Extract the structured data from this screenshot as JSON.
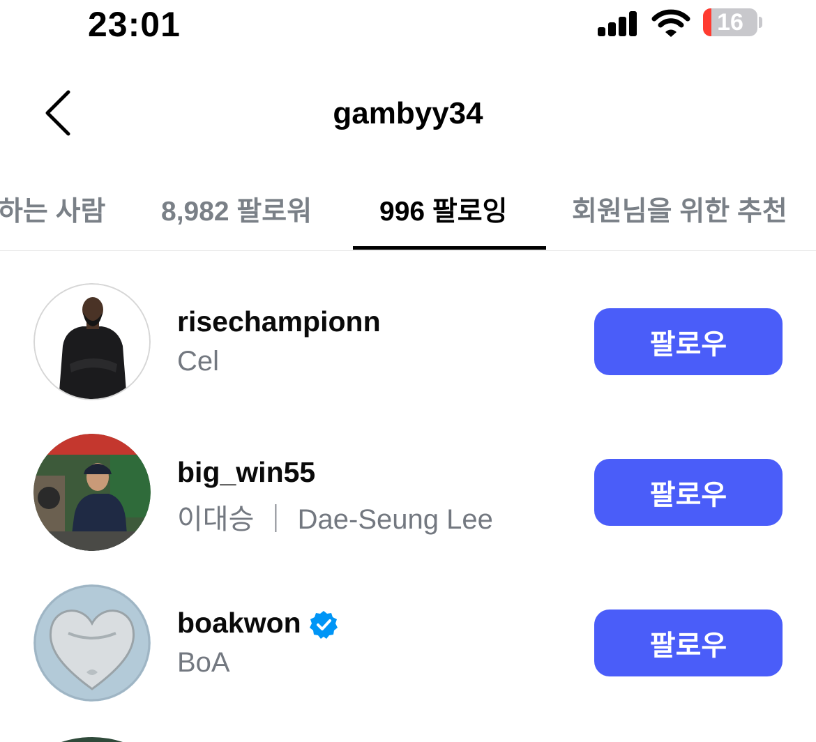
{
  "status_bar": {
    "time": "23:01",
    "battery_level": "16",
    "battery_fraction": 0.16,
    "icons": [
      "cellular-signal-icon",
      "wifi-icon",
      "battery-icon"
    ]
  },
  "header": {
    "back_icon": "chevron-left-icon",
    "title": "gambyy34"
  },
  "tabs": [
    {
      "label": "하는 사람",
      "active": false
    },
    {
      "label": "8,982 팔로워",
      "active": false
    },
    {
      "label": "996 팔로잉",
      "active": true
    },
    {
      "label": "회원님을 위한 추천",
      "active": false
    }
  ],
  "accounts": [
    {
      "username": "risechampionn",
      "full_name": "Cel",
      "verified": false,
      "button_label": "팔로우"
    },
    {
      "username": "big_win55",
      "full_name": "이대승 ｜ Dae-Seung Lee",
      "verified": false,
      "button_label": "팔로우"
    },
    {
      "username": "boakwon",
      "full_name": "BoA",
      "verified": true,
      "button_label": "팔로우"
    }
  ],
  "colors": {
    "follow_button": "#4a5df9",
    "verified_badge": "#0095f6",
    "secondary_text": "#737880",
    "battery_low": "#ff3b30"
  }
}
